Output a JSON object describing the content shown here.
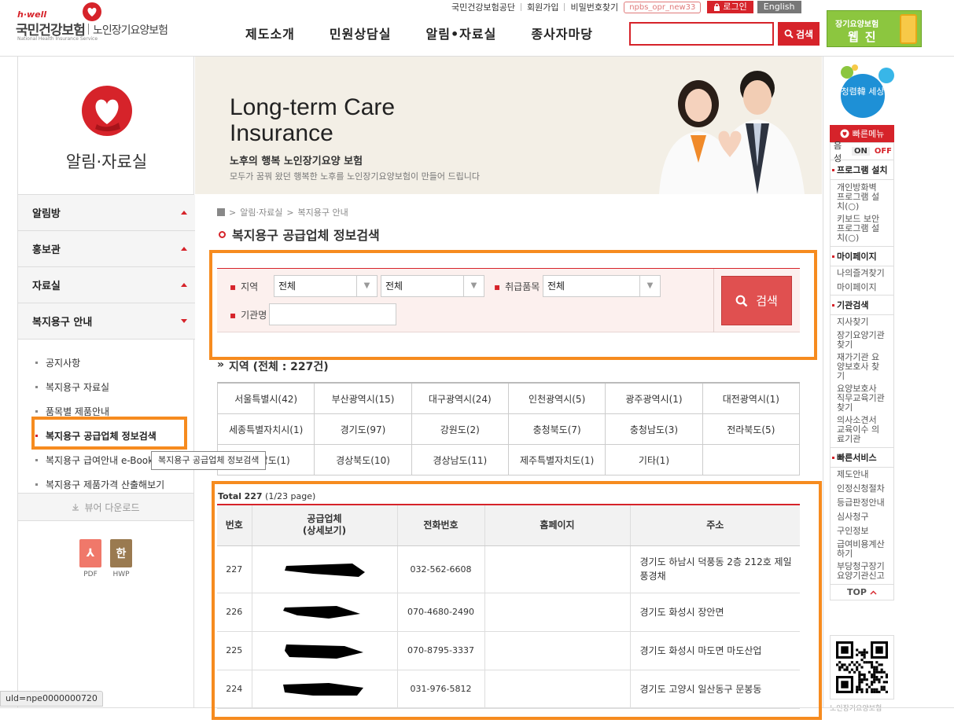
{
  "header": {
    "logo": {
      "hwell": "h·well",
      "nhis": "국민건강보험",
      "ltc": "노인장기요양보험",
      "eng": "National Health Insurance Service"
    },
    "util": {
      "nhis_link": "국민건강보험공단",
      "join": "회원가입",
      "find_pw": "비밀번호찾기",
      "user_id": "npbs_opr_new33",
      "login": "로그인",
      "english": "English"
    },
    "gnb": [
      "제도소개",
      "민원상담실",
      "알림•자료실",
      "종사자마당"
    ],
    "search_value": "",
    "search_btn": "검색",
    "webzine": {
      "line1": "장기요양보험",
      "line2": "웹진"
    }
  },
  "lnb": {
    "title": "알림·자료실",
    "menu": [
      {
        "label": "알림방"
      },
      {
        "label": "홍보관"
      },
      {
        "label": "자료실"
      },
      {
        "label": "복지용구 안내"
      }
    ],
    "sub": [
      "공지사항",
      "복지용구 자료실",
      "품목별 제품안내",
      "복지용구 공급업체 정보검색",
      "복지용구 급여안내 e-Book",
      "복지용구 제품가격 산출해보기"
    ],
    "tooltip": "복지용구 공급업체 정보검색",
    "viewer": "뷰어 다운로드",
    "pdf": "PDF",
    "hwp": "HWP"
  },
  "banner": {
    "title_line1": "Long-term Care",
    "title_line2": "Insurance",
    "sub1": "노후의 행복 노인장기요양 보험",
    "sub2": "모두가 꿈꿔 왔던 행복한 노후를 노인장기요양보험이 만들어 드립니다"
  },
  "content": {
    "breadcrumb": [
      "알림·자료실",
      "복지용구 안내"
    ],
    "page_title": "복지용구 공급업체 정보검색",
    "filter": {
      "region_label": "지역",
      "region1": "전체",
      "region2": "전체",
      "item_label": "취급품목",
      "item": "전체",
      "org_label": "기관명",
      "org_value": "",
      "search_btn": "검색"
    },
    "region_title": "지역 (전체 : 227건)",
    "regions": [
      [
        "서울특별시(42)",
        "부산광역시(15)",
        "대구광역시(24)",
        "인천광역시(5)",
        "광주광역시(1)",
        "대전광역시(1)"
      ],
      [
        "세종특별자치시(1)",
        "경기도(97)",
        "강원도(2)",
        "충청북도(7)",
        "충청남도(3)",
        "전라북도(5)"
      ],
      [
        "전라남도(1)",
        "경상북도(10)",
        "경상남도(11)",
        "제주특별자치도(1)",
        "기타(1)",
        ""
      ]
    ],
    "total_label": "Total",
    "total_count": "227",
    "total_page": "(1/23 page)",
    "columns": [
      "번호",
      "공급업체\n(상세보기)",
      "전화번호",
      "홈페이지",
      "주소"
    ],
    "col_supplier_1": "공급업체",
    "col_supplier_2": "(상세보기)",
    "rows": [
      {
        "no": "227",
        "tel": "032-562-6608",
        "home": "",
        "addr": "경기도 하남시 덕풍동 2층 212호 제일풍경채"
      },
      {
        "no": "226",
        "tel": "070-4680-2490",
        "home": "",
        "addr": "경기도 화성시 장안면"
      },
      {
        "no": "225",
        "tel": "070-8795-3337",
        "home": "",
        "addr": "경기도 화성시 마도면 마도산업"
      },
      {
        "no": "224",
        "tel": "031-976-5812",
        "home": "",
        "addr": "경기도 고양시 일산동구 문봉동"
      }
    ]
  },
  "quick": {
    "logo_text": "청렴韓 세상",
    "head": "빠른메뉴",
    "voice": "음성",
    "on": "ON",
    "off": "OFF",
    "sec_program": "프로그램 설치",
    "program_items": [
      "개인방화벽 프로그램 설치(○)",
      "키보드 보안 프로그램 설치(○)"
    ],
    "sec_mypage": "마이페이지",
    "mypage_items": [
      "나의즐겨찾기",
      "마이페이지"
    ],
    "sec_org": "기관검색",
    "org_items": [
      "지사찾기",
      "장기요양기관 찾기",
      "재가기관 요양보호사 찾기",
      "요양보호사 직무교육기관 찾기",
      "의사소견서 교육이수 의료기관"
    ],
    "sec_service": "빠른서비스",
    "service_items": [
      "제도안내",
      "인정신청절차",
      "등급판정안내",
      "심사청구",
      "구인정보",
      "급여비용계산하기",
      "부당청구장기요양기관신고"
    ],
    "top": "TOP",
    "foot": "노인장기요양보험"
  },
  "status": "uld=npe0000000720",
  "colors": {
    "accent": "#d6232a",
    "highlight": "#f68b1f"
  }
}
